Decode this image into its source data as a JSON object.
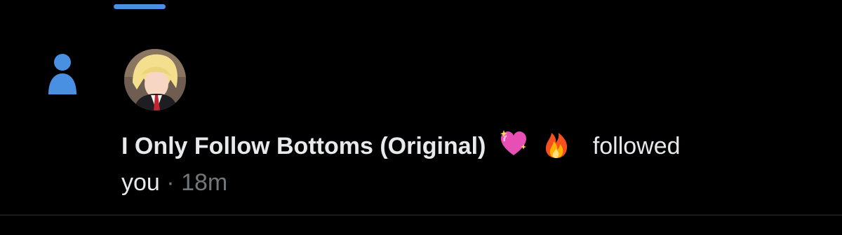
{
  "tabs": {
    "active_indicator_color": "#4a90e2"
  },
  "notification": {
    "type_icon": "person-icon",
    "type_icon_color": "#4a90e2",
    "avatar": "profile-avatar",
    "author_name": "I Only Follow Bottoms (Original)",
    "emojis": [
      "sparkling-heart-icon",
      "fire-icon"
    ],
    "action": "followed",
    "action_continuation": "you",
    "separator": "·",
    "time": "18m"
  }
}
